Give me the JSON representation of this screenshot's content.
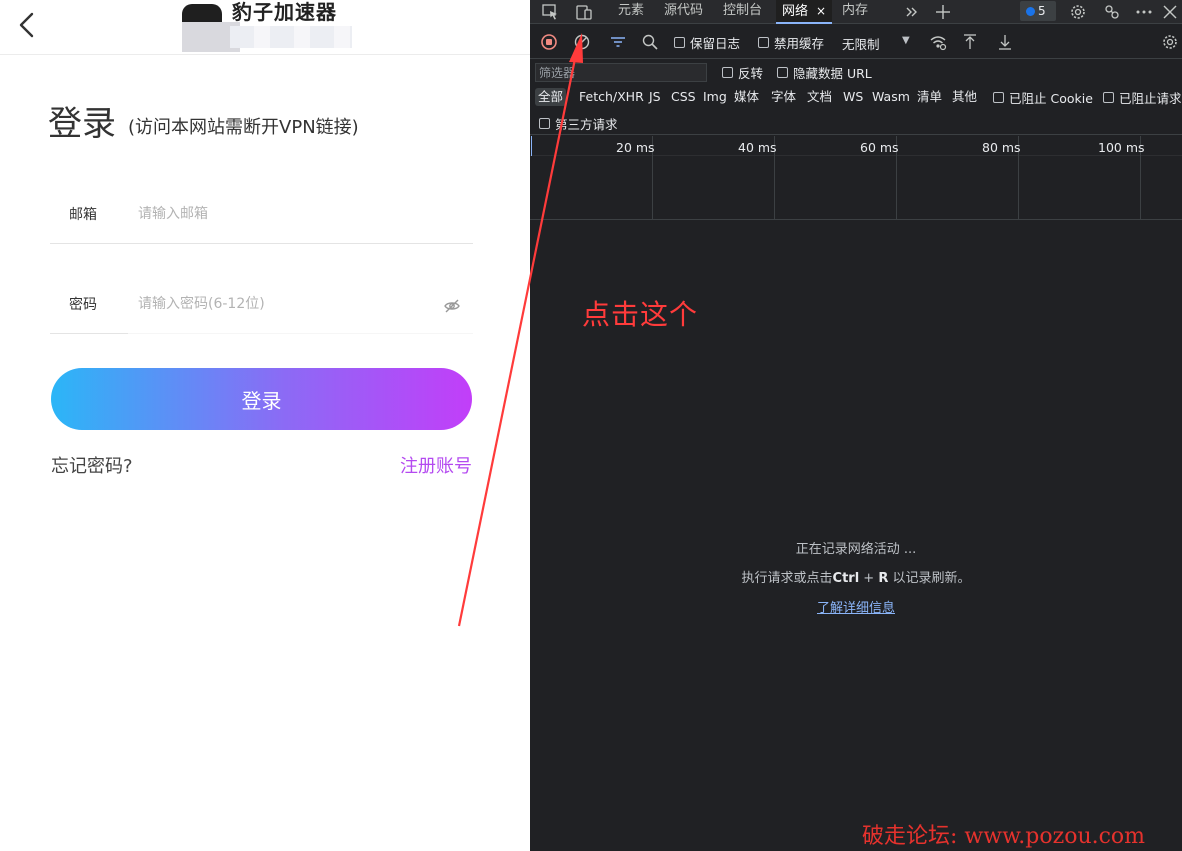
{
  "app": {
    "header_title": "豹子加速器",
    "login_title": "登录",
    "login_subtitle": "(访问本网站需断开VPN链接)",
    "email_label": "邮箱",
    "email_placeholder": "请输入邮箱",
    "password_label": "密码",
    "password_placeholder": "请输入密码(6-12位)",
    "login_button": "登录",
    "forgot_password": "忘记密码?",
    "register": "注册账号"
  },
  "devtools": {
    "tabs": [
      {
        "label": "元素"
      },
      {
        "label": "源代码"
      },
      {
        "label": "控制台"
      },
      {
        "label": "网络",
        "active": true
      },
      {
        "label": "内存"
      }
    ],
    "tab_close": "×",
    "issues_count": "5",
    "toolbar": {
      "preserve_log": "保留日志",
      "disable_cache": "禁用缓存",
      "throttling": "无限制",
      "throttle_arrow": "▼"
    },
    "filter": {
      "placeholder": "筛选器",
      "invert": "反转",
      "hide_data_urls": "隐藏数据 URL"
    },
    "types": [
      "全部",
      "Fetch/XHR",
      "JS",
      "CSS",
      "Img",
      "媒体",
      "字体",
      "文档",
      "WS",
      "Wasm",
      "清单",
      "其他"
    ],
    "blocked_cookies": "已阻止 Cookie",
    "blocked_requests": "已阻止请求",
    "third_party": "第三方请求",
    "timeline_ticks": [
      "20 ms",
      "40 ms",
      "60 ms",
      "80 ms",
      "100 ms"
    ],
    "empty_state": {
      "line1": "正在记录网络活动 ...",
      "line2_prefix": "执行请求或点击",
      "line2_key1": "Ctrl",
      "line2_plus": " + ",
      "line2_key2": "R",
      "line2_suffix": " 以记录刷新。",
      "link": "了解详细信息"
    }
  },
  "annotation": {
    "callout": "点击这个",
    "color": "#ff3b3b"
  },
  "watermark": "破走论坛: www.pozou.com",
  "colors": {
    "accent_gradient_start": "#2bb6f7",
    "accent_gradient_end": "#c23ef9",
    "register_link": "#b44af0",
    "devtools_bg": "#202124",
    "record_button": "#f28b82"
  }
}
